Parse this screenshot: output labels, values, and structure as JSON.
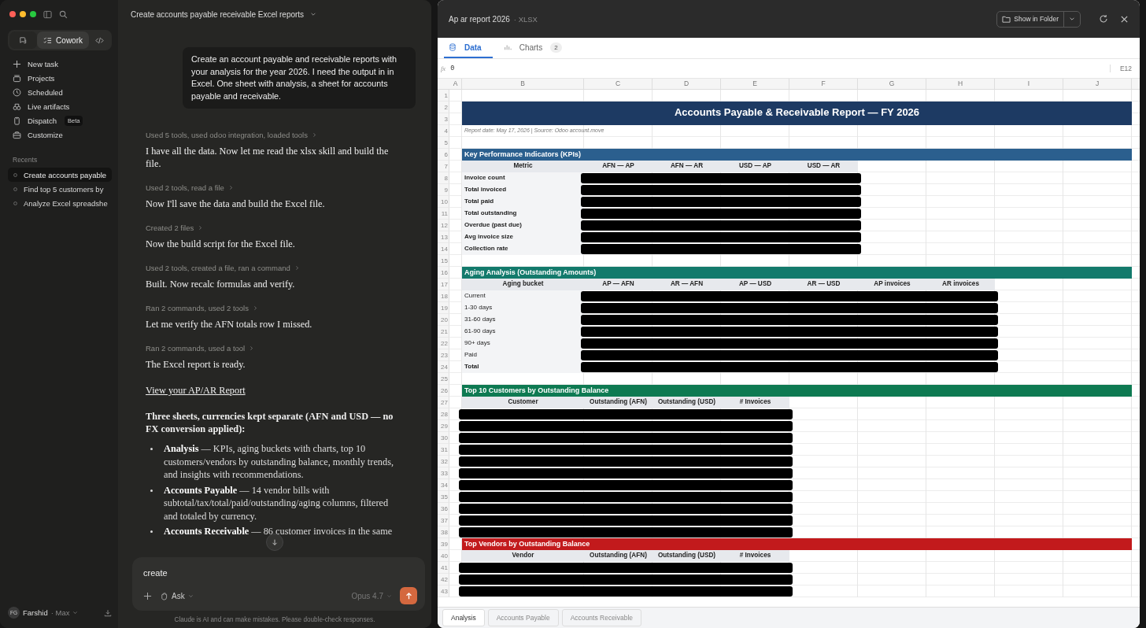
{
  "sidebar": {
    "mode_tabs": [
      {
        "kind": "chat",
        "selected": false
      },
      {
        "kind": "cowork",
        "label": "Cowork",
        "selected": true
      },
      {
        "kind": "code",
        "selected": false
      }
    ],
    "nav": [
      {
        "label": "New task"
      },
      {
        "label": "Projects"
      },
      {
        "label": "Scheduled"
      },
      {
        "label": "Live artifacts"
      },
      {
        "label": "Dispatch",
        "badge": "Beta"
      },
      {
        "label": "Customize"
      }
    ],
    "recents_heading": "Recents",
    "recents": [
      {
        "label": "Create accounts payable",
        "selected": true
      },
      {
        "label": "Find top 5 customers by",
        "selected": false
      },
      {
        "label": "Analyze Excel spreadshe",
        "selected": false
      }
    ],
    "user": {
      "initials": "FG",
      "name": "Farshid",
      "plan": "· Max"
    }
  },
  "chat": {
    "title": "Create accounts payable receivable Excel reports",
    "user_message": "Create an account payable and receivable reports with your analysis for the year 2026. I need the output in in Excel. One sheet with analysis, a sheet for accounts payable and receivable.",
    "messages": [
      {
        "kind": "tool",
        "text": "Used 5 tools, used odoo integration, loaded tools"
      },
      {
        "kind": "text",
        "text": "I have all the data. Now let me read the xlsx skill and build the file."
      },
      {
        "kind": "tool",
        "text": "Used 2 tools, read a file"
      },
      {
        "kind": "text",
        "text": "Now I'll save the data and build the Excel file."
      },
      {
        "kind": "tool",
        "text": "Created 2 files"
      },
      {
        "kind": "text",
        "text": "Now the build script for the Excel file."
      },
      {
        "kind": "tool",
        "text": "Used 2 tools, created a file, ran a command"
      },
      {
        "kind": "text",
        "text": "Built. Now recalc formulas and verify."
      },
      {
        "kind": "tool",
        "text": "Ran 2 commands, used 2 tools"
      },
      {
        "kind": "text",
        "text": "Let me verify the AFN totals row I missed."
      },
      {
        "kind": "tool",
        "text": "Ran 2 commands, used a tool"
      },
      {
        "kind": "text",
        "text": "The Excel report is ready."
      },
      {
        "kind": "link",
        "text": "View your AP/AR Report"
      },
      {
        "kind": "bold",
        "text": "Three sheets, currencies kept separate (AFN and USD — no FX conversion applied):"
      },
      {
        "kind": "bullets",
        "items": [
          "**Analysis** — KPIs, aging buckets with charts, top 10 customers/vendors by outstanding balance, monthly trends, and insights with recommendations.",
          "**Accounts Payable** — 14 vendor bills with subtotal/tax/total/paid/outstanding/aging columns, filtered and totaled by currency.",
          "**Accounts Receivable** — 86 customer invoices in the same"
        ]
      }
    ],
    "composer": {
      "value": "create",
      "mode": "Ask",
      "model": "Opus 4.7"
    },
    "disclaimer": "Claude is AI and can make mistakes. Please double-check responses."
  },
  "preview": {
    "title": "Ap ar report 2026",
    "type": "· XLSX",
    "folder_button": "Show in Folder",
    "tabs": [
      {
        "label": "Data",
        "selected": true
      },
      {
        "label": "Charts",
        "badge": "2",
        "selected": false
      }
    ],
    "formula": {
      "fx": "fx",
      "value": "0",
      "cell": "E12"
    },
    "columns": [
      "A",
      "B",
      "C",
      "D",
      "E",
      "F",
      "G",
      "H",
      "I",
      "J"
    ],
    "rows": [
      {
        "nums": [
          "1"
        ],
        "kind": "blank"
      },
      {
        "nums": [
          "2",
          "3"
        ],
        "kind": "title",
        "title": "Accounts Payable & Receivable Report — FY 2026"
      },
      {
        "nums": [
          "4"
        ],
        "kind": "note",
        "text": "Report date: May 17, 2026   |   Source: Odoo account.move"
      },
      {
        "nums": [
          "5"
        ],
        "kind": "blank"
      },
      {
        "nums": [
          "6"
        ],
        "kind": "section",
        "text": "Key Performance Indicators (KPIs)",
        "color": "#2b5f8e"
      },
      {
        "nums": [
          "7"
        ],
        "kind": "header",
        "cells": [
          "Metric",
          "AFN — AP",
          "AFN — AR",
          "USD — AP",
          "USD — AR"
        ]
      },
      {
        "nums": [
          "8"
        ],
        "kind": "data",
        "cells": [
          {
            "text": "Invoice count",
            "bold": true
          }
        ],
        "redacted": true
      },
      {
        "nums": [
          "9"
        ],
        "kind": "data",
        "cells": [
          {
            "text": "Total invoiced",
            "bold": true
          }
        ],
        "redacted": true
      },
      {
        "nums": [
          "10"
        ],
        "kind": "data",
        "cells": [
          {
            "text": "Total paid",
            "bold": true
          }
        ],
        "redacted": true
      },
      {
        "nums": [
          "11"
        ],
        "kind": "data",
        "cells": [
          {
            "text": "Total outstanding",
            "bold": true
          }
        ],
        "redacted": true
      },
      {
        "nums": [
          "12"
        ],
        "kind": "data",
        "cells": [
          {
            "text": "Overdue (past due)",
            "bold": true
          }
        ],
        "redacted": true
      },
      {
        "nums": [
          "13"
        ],
        "kind": "data",
        "cells": [
          {
            "text": "Avg invoice size",
            "bold": true
          }
        ],
        "redacted": true
      },
      {
        "nums": [
          "14"
        ],
        "kind": "data",
        "cells": [
          {
            "text": "Collection rate",
            "bold": true
          }
        ],
        "redacted": true
      },
      {
        "nums": [
          "15"
        ],
        "kind": "blank"
      },
      {
        "nums": [
          "16"
        ],
        "kind": "section",
        "text": "Aging Analysis (Outstanding Amounts)",
        "color": "#137a6c"
      },
      {
        "nums": [
          "17"
        ],
        "kind": "header",
        "cells": [
          "Aging bucket",
          "AP — AFN",
          "AR — AFN",
          "AP — USD",
          "AR — USD",
          "AP invoices",
          "AR invoices"
        ]
      },
      {
        "nums": [
          "18"
        ],
        "kind": "data",
        "cells": [
          {
            "text": "Current",
            "bold": false
          }
        ],
        "redacted": true
      },
      {
        "nums": [
          "19"
        ],
        "kind": "data",
        "cells": [
          {
            "text": "1-30 days",
            "bold": false
          }
        ],
        "redacted": true
      },
      {
        "nums": [
          "20"
        ],
        "kind": "data",
        "cells": [
          {
            "text": "31-60 days",
            "bold": false
          }
        ],
        "redacted": true
      },
      {
        "nums": [
          "21"
        ],
        "kind": "data",
        "cells": [
          {
            "text": "61-90 days",
            "bold": false
          }
        ],
        "redacted": true
      },
      {
        "nums": [
          "22"
        ],
        "kind": "data",
        "cells": [
          {
            "text": "90+ days",
            "bold": false
          }
        ],
        "redacted": true
      },
      {
        "nums": [
          "23"
        ],
        "kind": "data",
        "cells": [
          {
            "text": "Paid",
            "bold": false
          }
        ],
        "redacted": true
      },
      {
        "nums": [
          "24"
        ],
        "kind": "data",
        "cells": [
          {
            "text": "Total",
            "bold": true
          }
        ],
        "redacted": true
      },
      {
        "nums": [
          "25"
        ],
        "kind": "blank"
      },
      {
        "nums": [
          "26"
        ],
        "kind": "section",
        "text": "Top 10 Customers by Outstanding Balance",
        "color": "#0e7a52"
      },
      {
        "nums": [
          "27"
        ],
        "kind": "header",
        "cells": [
          "Customer",
          "Outstanding (AFN)",
          "Outstanding (USD)",
          "# Invoices"
        ]
      },
      {
        "nums": [
          "28"
        ],
        "kind": "data",
        "redacted": true
      },
      {
        "nums": [
          "29"
        ],
        "kind": "data",
        "redacted": true
      },
      {
        "nums": [
          "30"
        ],
        "kind": "data",
        "redacted": true
      },
      {
        "nums": [
          "31"
        ],
        "kind": "data",
        "redacted": true
      },
      {
        "nums": [
          "32"
        ],
        "kind": "data",
        "redacted": true
      },
      {
        "nums": [
          "33"
        ],
        "kind": "data",
        "redacted": true
      },
      {
        "nums": [
          "34"
        ],
        "kind": "data",
        "redacted": true
      },
      {
        "nums": [
          "35"
        ],
        "kind": "data",
        "redacted": true
      },
      {
        "nums": [
          "36"
        ],
        "kind": "data",
        "redacted": true
      },
      {
        "nums": [
          "37"
        ],
        "kind": "data",
        "redacted": true
      },
      {
        "nums": [
          "38"
        ],
        "kind": "data",
        "redacted": true
      },
      {
        "nums": [
          "39"
        ],
        "kind": "section",
        "text": "Top Vendors by Outstanding Balance",
        "color": "#c21a1c"
      },
      {
        "nums": [
          "40"
        ],
        "kind": "header",
        "cells": [
          "Vendor",
          "Outstanding (AFN)",
          "Outstanding (USD)",
          "# Invoices"
        ]
      },
      {
        "nums": [
          "41"
        ],
        "kind": "data",
        "redacted": true
      },
      {
        "nums": [
          "42"
        ],
        "kind": "data",
        "redacted": true
      },
      {
        "nums": [
          "43"
        ],
        "kind": "data",
        "redacted": true
      }
    ],
    "sheet_tabs": [
      {
        "label": "Analysis",
        "selected": true
      },
      {
        "label": "Accounts Payable",
        "selected": false
      },
      {
        "label": "Accounts Receivable",
        "selected": false
      }
    ]
  }
}
